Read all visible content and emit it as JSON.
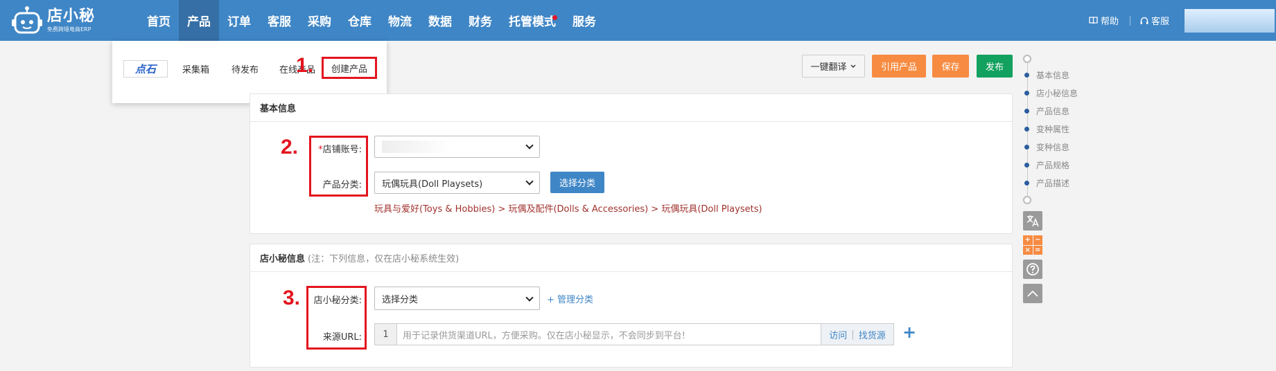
{
  "app": {
    "logo_name": "店小秘",
    "logo_sub": "免费跨境电商ERP",
    "robot_icon": "robot-logo-icon"
  },
  "nav": {
    "items": [
      {
        "label": "首页"
      },
      {
        "label": "产品",
        "active": true
      },
      {
        "label": "订单"
      },
      {
        "label": "客服"
      },
      {
        "label": "采购"
      },
      {
        "label": "仓库"
      },
      {
        "label": "物流"
      },
      {
        "label": "数据"
      },
      {
        "label": "财务"
      },
      {
        "label": "托管模式",
        "badge": true
      },
      {
        "label": "服务"
      }
    ],
    "help_label": "帮助",
    "service_label": "客服"
  },
  "dropdown": {
    "logo_text": "点石",
    "items": [
      "采集箱",
      "待发布",
      "在线产品"
    ],
    "create_label": "创建产品"
  },
  "markers": {
    "m1": "1.",
    "m2": "2.",
    "m3": "3."
  },
  "toolbar": {
    "translate_label": "一键翻译",
    "cite_label": "引用产品",
    "save_label": "保存",
    "publish_label": "发布"
  },
  "basic_info": {
    "title": "基本信息",
    "store_label": "店铺账号:",
    "category_label": "产品分类:",
    "category_value": "玩偶玩具(Doll Playsets)",
    "choose_category_btn": "选择分类",
    "category_path": "玩具与爱好(Toys & Hobbies) > 玩偶及配件(Dolls & Accessories) > 玩偶玩具(Doll Playsets)"
  },
  "dxm_info": {
    "title": "店小秘信息",
    "note": "(注：下列信息，仅在店小秘系统生效)",
    "dxm_category_label": "店小秘分类:",
    "dxm_category_value": "选择分类",
    "manage_category_link": "+ 管理分类",
    "source_url_label": "来源URL:",
    "url_index": "1",
    "url_placeholder": "用于记录供货渠道URL，方便采购。仅在店小秘显示，不会同步到平台!",
    "visit_label": "访问",
    "find_source_label": "找货源",
    "add_symbol": "+"
  },
  "anchor_nav": {
    "items": [
      "基本信息",
      "店小秘信息",
      "产品信息",
      "变种属性",
      "变种信息",
      "产品规格",
      "产品描述"
    ]
  },
  "colors": {
    "nav_bg": "#3f86c6",
    "accent_orange": "#f78b41",
    "publish_green": "#13a15f",
    "annotation_red": "#e3141e"
  }
}
